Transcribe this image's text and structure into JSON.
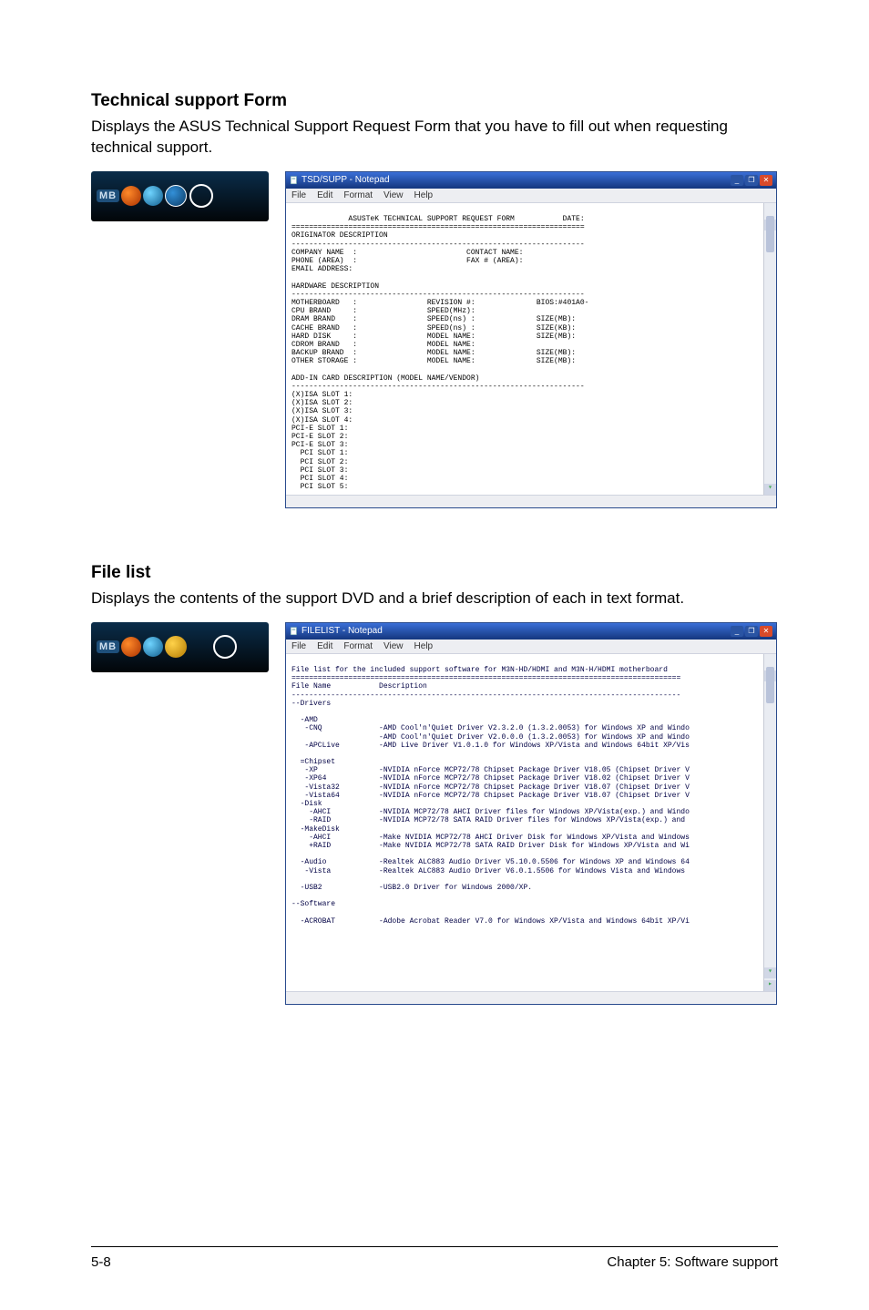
{
  "section1": {
    "heading": "Technical support Form",
    "intro": "Displays the ASUS Technical Support Request Form that you have to fill out when requesting technical support.",
    "window_title": "TSD/SUPP - Notepad",
    "menu": [
      "File",
      "Edit",
      "Format",
      "View",
      "Help"
    ],
    "body": "             ASUSTeK TECHNICAL SUPPORT REQUEST FORM           DATE:\n===================================================================\nORIGINATOR DESCRIPTION\n-------------------------------------------------------------------\nCOMPANY NAME  :                         CONTACT NAME:\nPHONE (AREA)  :                         FAX # (AREA):\nEMAIL ADDRESS:\n\nHARDWARE DESCRIPTION\n-------------------------------------------------------------------\nMOTHERBOARD   :                REVISION #:              BIOS:#401A0-\nCPU BRAND     :                SPEED(MHz):\nDRAM BRAND    :                SPEED(ns) :              SIZE(MB):\nCACHE BRAND   :                SPEED(ns) :              SIZE(KB):\nHARD DISK     :                MODEL NAME:              SIZE(MB):\nCDROM BRAND   :                MODEL NAME:\nBACKUP BRAND  :                MODEL NAME:              SIZE(MB):\nOTHER STORAGE :                MODEL NAME:              SIZE(MB):\n\nADD-IN CARD DESCRIPTION (MODEL NAME/VENDOR)\n-------------------------------------------------------------------\n(X)ISA SLOT 1:\n(X)ISA SLOT 2:\n(X)ISA SLOT 3:\n(X)ISA SLOT 4:\nPCI-E SLOT 1:\nPCI-E SLOT 2:\nPCI-E SLOT 3:\n  PCI SLOT 1:\n  PCI SLOT 2:\n  PCI SLOT 3:\n  PCI SLOT 4:\n  PCI SLOT 5:"
  },
  "section2": {
    "heading": "File list",
    "intro": "Displays the contents of the support DVD and a brief description of each in text format.",
    "window_title": "FILELIST - Notepad",
    "menu": [
      "File",
      "Edit",
      "Format",
      "View",
      "Help"
    ],
    "body": "File list for the included support software for M3N-HD/HDMI and M3N-H/HDMI motherboard\n=========================================================================================\nFile Name           Description\n-----------------------------------------------------------------------------------------\n--Drivers\n\n  -AMD\n   -CNQ             -AMD Cool'n'Quiet Driver V2.3.2.0 (1.3.2.0053) for Windows XP and Windo\n                    -AMD Cool'n'Quiet Driver V2.0.0.0 (1.3.2.0053) for Windows XP and Windo\n   -APCLive         -AMD Live Driver V1.0.1.0 for Windows XP/Vista and Windows 64bit XP/Vis\n\n  =Chipset\n   -XP              -NVIDIA nForce MCP72/78 Chipset Package Driver V18.05 (Chipset Driver V\n   -XP64            -NVIDIA nForce MCP72/78 Chipset Package Driver V18.02 (Chipset Driver V\n   -Vista32         -NVIDIA nForce MCP72/78 Chipset Package Driver V18.07 (Chipset Driver V\n   -Vista64         -NVIDIA nForce MCP72/78 Chipset Package Driver V18.07 (Chipset Driver V\n  -Disk\n    -AHCI           -NVIDIA MCP72/78 AHCI Driver files for Windows XP/Vista(exp.) and Windo\n    -RAID           -NVIDIA MCP72/78 SATA RAID Driver files for Windows XP/Vista(exp.) and \n  -MakeDisk\n    -AHCI           -Make NVIDIA MCP72/78 AHCI Driver Disk for Windows XP/Vista and Windows\n    +RAID           -Make NVIDIA MCP72/78 SATA RAID Driver Disk for Windows XP/Vista and Wi\n\n  -Audio            -Realtek ALC883 Audio Driver V5.10.0.5506 for Windows XP and Windows 64\n   -Vista           -Realtek ALC883 Audio Driver V6.0.1.5506 for Windows Vista and Windows \n\n  -USB2             -USB2.0 Driver for Windows 2000/XP.\n\n--Software\n\n  -ACROBAT          -Adobe Acrobat Reader V7.0 for Windows XP/Vista and Windows 64bit XP/Vi"
  },
  "win": {
    "min": "_",
    "max": "❐",
    "close": "✕"
  },
  "footer": {
    "left": "5-8",
    "right": "Chapter 5: Software support"
  }
}
